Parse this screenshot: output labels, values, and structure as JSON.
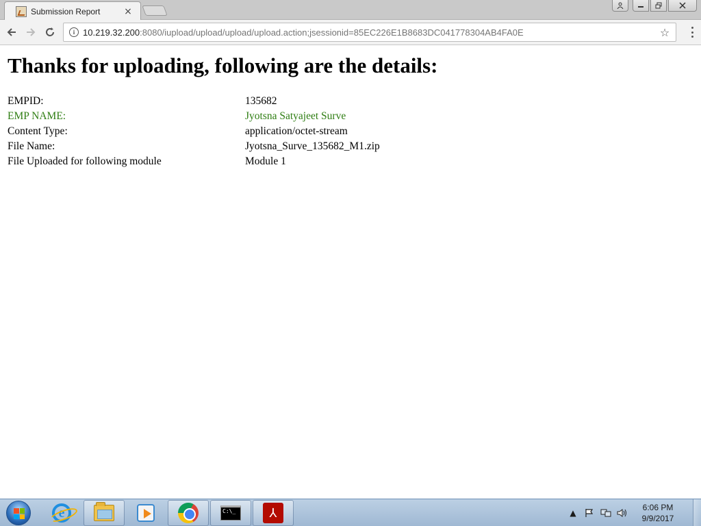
{
  "browser": {
    "tab_title": "Submission Report",
    "tab_close": "×",
    "url_host": "10.219.32.200",
    "url_rest": ":8080/iupload/upload/upload/upload.action;jsessionid=85EC226E1B8683DC041778304AB4FA0E",
    "star": "☆"
  },
  "page": {
    "heading": "Thanks for uploading, following are the details:",
    "details": [
      {
        "label": "EMPID:",
        "value": "135682"
      },
      {
        "label": "EMP NAME:",
        "value": "Jyotsna Satyajeet Surve"
      },
      {
        "label": "Content Type:",
        "value": "application/octet-stream"
      },
      {
        "label": "File Name:",
        "value": "Jyotsna_Surve_135682_M1.zip"
      },
      {
        "label": "File Uploaded for following module",
        "value": "Module 1"
      }
    ],
    "highlight_color": "#2e7d12"
  },
  "taskbar": {
    "apps": [
      "internet-explorer-icon",
      "file-explorer-icon",
      "media-player-icon",
      "chrome-icon",
      "command-prompt-icon",
      "acrobat-icon"
    ],
    "clock_time": "6:06 PM",
    "clock_date": "9/9/2017"
  }
}
